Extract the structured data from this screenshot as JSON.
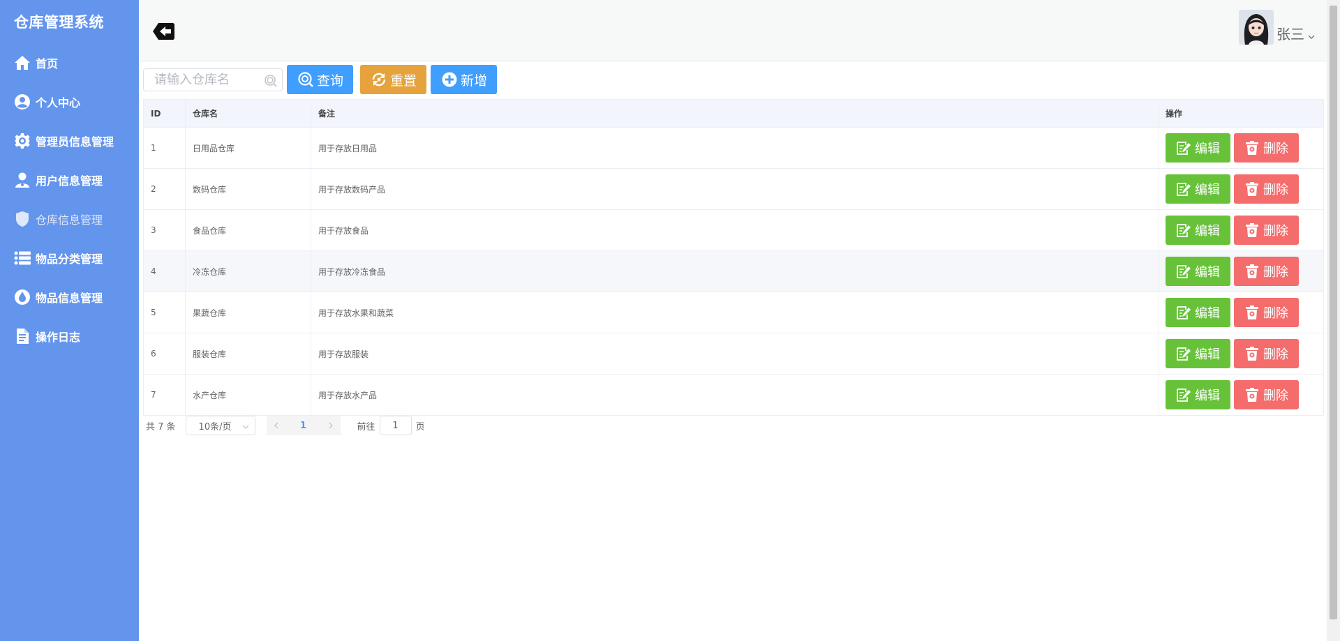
{
  "app": {
    "title": "仓库管理系统"
  },
  "sidebar": {
    "items": [
      {
        "label": "首页",
        "icon": "home-icon"
      },
      {
        "label": "个人中心",
        "icon": "user-circle-icon"
      },
      {
        "label": "管理员信息管理",
        "icon": "gear-icon"
      },
      {
        "label": "用户信息管理",
        "icon": "user-icon"
      },
      {
        "label": "仓库信息管理",
        "icon": "shield-icon",
        "active": true
      },
      {
        "label": "物品分类管理",
        "icon": "list-icon"
      },
      {
        "label": "物品信息管理",
        "icon": "drop-icon"
      },
      {
        "label": "操作日志",
        "icon": "document-icon"
      }
    ]
  },
  "header": {
    "username": "张三"
  },
  "toolbar": {
    "search_placeholder": "请输入仓库名",
    "query_label": "查询",
    "reset_label": "重置",
    "add_label": "新增"
  },
  "table": {
    "columns": [
      "ID",
      "仓库名",
      "备注",
      "操作"
    ],
    "rows": [
      {
        "id": "1",
        "name": "日用品仓库",
        "remark": "用于存放日用品"
      },
      {
        "id": "2",
        "name": "数码仓库",
        "remark": "用于存放数码产品"
      },
      {
        "id": "3",
        "name": "食品仓库",
        "remark": "用于存放食品"
      },
      {
        "id": "4",
        "name": "冷冻仓库",
        "remark": "用于存放冷冻食品"
      },
      {
        "id": "5",
        "name": "果蔬仓库",
        "remark": "用于存放水果和蔬菜"
      },
      {
        "id": "6",
        "name": "服装仓库",
        "remark": "用于存放服装"
      },
      {
        "id": "7",
        "name": "水产仓库",
        "remark": "用于存放水产品"
      }
    ],
    "edit_label": "编辑",
    "delete_label": "删除"
  },
  "pagination": {
    "total_text": "共 7 条",
    "page_size": "10条/页",
    "current_page": "1",
    "goto_prefix": "前往",
    "goto_value": "1",
    "goto_suffix": "页"
  },
  "colors": {
    "sidebar": "#6495ed",
    "primary": "#409eff",
    "warning": "#e6a23c",
    "success": "#67c23a",
    "danger": "#f56c6c"
  }
}
